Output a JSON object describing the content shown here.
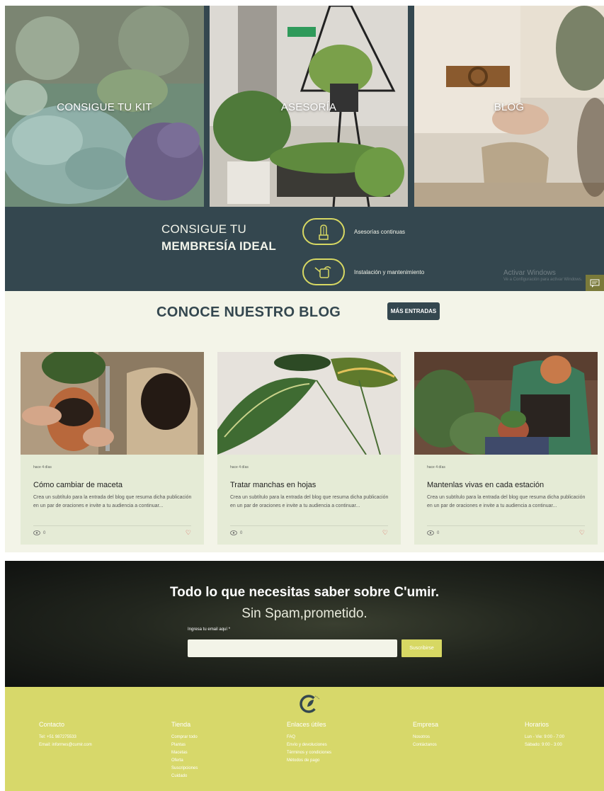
{
  "hero": {
    "tiles": [
      {
        "title": "CONSIGUE TU KIT"
      },
      {
        "title": "ASESORÍA"
      },
      {
        "title": "BLOG"
      }
    ]
  },
  "membership": {
    "title_line1": "CONSIGUE TU",
    "title_line2": "MEMBRESÍA IDEAL",
    "features": [
      {
        "label": "Asesorías continuas",
        "icon": "cactus-icon"
      },
      {
        "label": "Instalación y mantenimiento",
        "icon": "watering-can-icon"
      }
    ]
  },
  "windows_watermark": {
    "line1": "Activar Windows",
    "line2": "Ve a Configuración para activar Windows."
  },
  "blog": {
    "title": "CONOCE NUESTRO BLOG",
    "more_button": "MÁS ENTRADAS",
    "posts": [
      {
        "date": "hace 4 días",
        "title": "Cómo cambiar de maceta",
        "excerpt": "Crea un subtítulo para la entrada del blog que resuma dicha publicación en un par de oraciones e invite a tu audiencia a continuar...",
        "views": "0"
      },
      {
        "date": "hace 4 días",
        "title": "Tratar manchas en hojas",
        "excerpt": "Crea un subtítulo para la entrada del blog que resuma dicha publicación en un par de oraciones e invite a tu audiencia a continuar...",
        "views": "0"
      },
      {
        "date": "hace 4 días",
        "title": "Mantenlas vivas en cada estación",
        "excerpt": "Crea un subtítulo para la entrada del blog que resuma dicha publicación en un par de oraciones e invite a tu audiencia a continuar...",
        "views": "0"
      }
    ]
  },
  "newsletter": {
    "title": "Todo lo que necesitas saber sobre C'umir.",
    "subtitle": "Sin Spam,prometido.",
    "email_label": "Ingresa tu email aquí *",
    "email_value": "",
    "submit": "Suscribirse"
  },
  "footer": {
    "columns": [
      {
        "heading": "Contacto",
        "items": [
          "Tel: +51 987275533",
          "Email: informes@cumir.com"
        ]
      },
      {
        "heading": "Tienda",
        "items": [
          "Comprar todo",
          "Plantas",
          "Macetas",
          "Oferta",
          "Suscripciones",
          "Cuidado"
        ]
      },
      {
        "heading": "Enlaces útiles",
        "items": [
          "FAQ",
          "Envío y devoluciones",
          "Términos y condiciones",
          "Métodos de pago"
        ]
      },
      {
        "heading": "Empresa",
        "items": [
          "Nosotros",
          "Contáctanos"
        ]
      },
      {
        "heading": "Horarios",
        "items": [
          "Lun - Vie: 9:00 - 7:00",
          "Sábado: 9:00 - 3:00"
        ]
      }
    ]
  },
  "colors": {
    "slate": "#34474f",
    "cream": "#f3f4e8",
    "card": "#e5ebd6",
    "lime": "#d7d86a",
    "accent_yellow": "#d7d863",
    "heart": "#d9453e"
  }
}
